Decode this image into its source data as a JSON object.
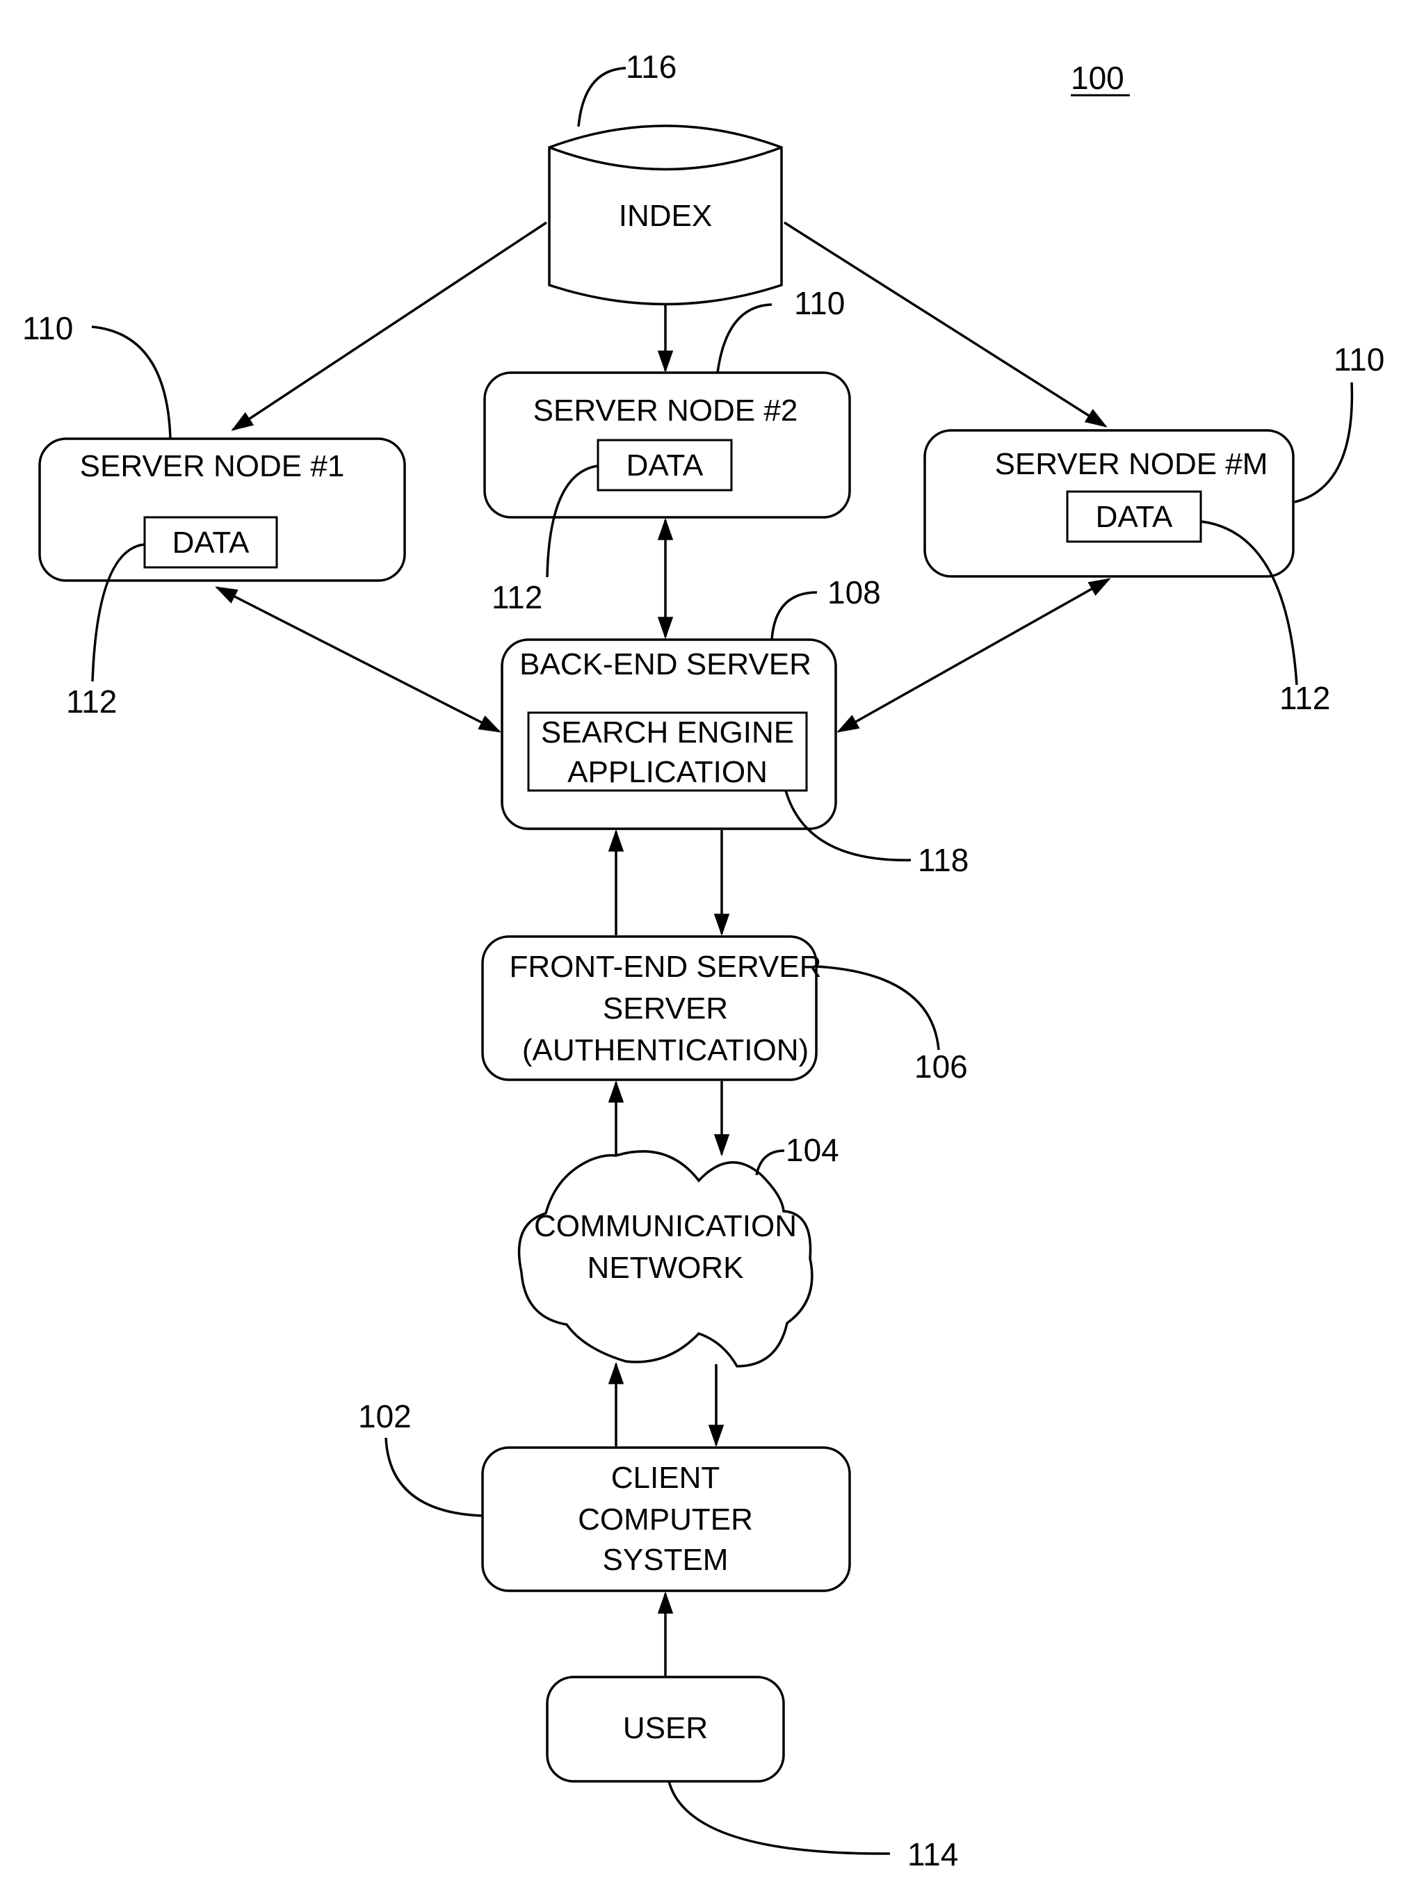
{
  "figure_number": "100",
  "index": {
    "label": "INDEX",
    "ref": "116"
  },
  "server_nodes": [
    {
      "title": "SERVER NODE #1",
      "data_label": "DATA",
      "ref": "110",
      "data_ref": "112"
    },
    {
      "title": "SERVER NODE #2",
      "data_label": "DATA",
      "ref": "110",
      "data_ref": "112"
    },
    {
      "title": "SERVER NODE #M",
      "data_label": "DATA",
      "ref": "110",
      "data_ref": "112"
    }
  ],
  "back_end": {
    "title": "BACK-END SERVER",
    "app_line1": "SEARCH ENGINE",
    "app_line2": "APPLICATION",
    "ref": "108",
    "app_ref": "118"
  },
  "front_end": {
    "line1": "FRONT-END SERVER",
    "line2": "SERVER",
    "line3": "(AUTHENTICATION)",
    "ref": "106"
  },
  "network": {
    "line1": "COMMUNICATION",
    "line2": "NETWORK",
    "ref": "104"
  },
  "client": {
    "line1": "CLIENT",
    "line2": "COMPUTER",
    "line3": "SYSTEM",
    "ref": "102"
  },
  "user": {
    "label": "USER",
    "ref": "114"
  }
}
